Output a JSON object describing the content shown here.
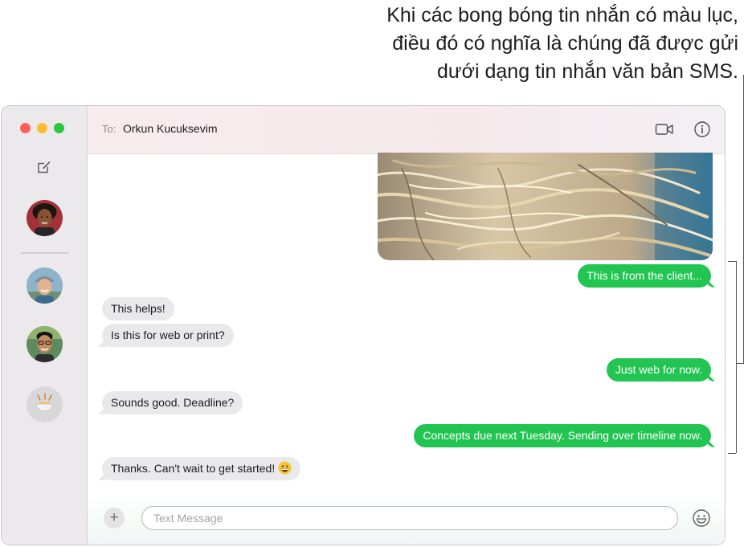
{
  "callout": {
    "line1": "Khi các bong bóng tin nhắn có màu lục,",
    "line2": "điều đó có nghĩa là chúng đã được gửi",
    "line3": "dưới dạng tin nhắn văn bản SMS."
  },
  "header": {
    "to_label": "To:",
    "recipient": "Orkun Kucuksevim"
  },
  "messages": [
    {
      "direction": "out",
      "text": "This is from the client..."
    },
    {
      "direction": "in",
      "text": "This helps!"
    },
    {
      "direction": "in",
      "text": "Is this for web or print?"
    },
    {
      "direction": "out",
      "text": "Just web for now."
    },
    {
      "direction": "in",
      "text": "Sounds good. Deadline?"
    },
    {
      "direction": "out",
      "text": "Concepts due next Tuesday. Sending over timeline now."
    },
    {
      "direction": "in",
      "text": "Thanks. Can't wait to get started!",
      "emoji": "grinning-face"
    }
  ],
  "input": {
    "placeholder": "Text Message"
  },
  "icons": {
    "compose": "compose-icon",
    "video": "video-camera-icon",
    "info": "info-icon",
    "plus": "plus-icon",
    "emoji": "emoji-icon"
  },
  "colors": {
    "sms_bubble": "#23c552",
    "received_bubble": "#e9e9eb",
    "close": "#fe5f57",
    "minimize": "#febc2e",
    "zoom": "#28c840"
  }
}
